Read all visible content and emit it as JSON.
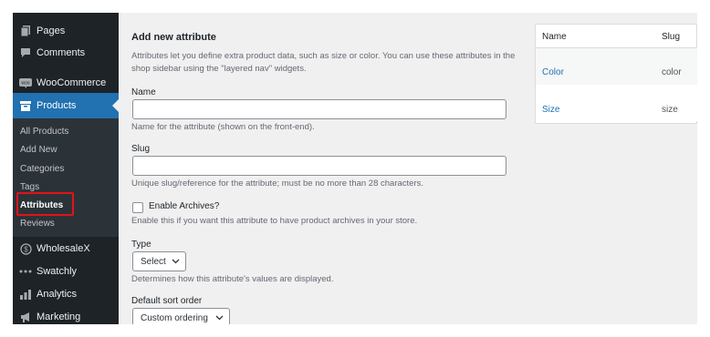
{
  "sidebar": {
    "items": [
      {
        "label": "Pages",
        "icon": "pages-icon"
      },
      {
        "label": "Comments",
        "icon": "comments-icon"
      },
      {
        "label": "WooCommerce",
        "icon": "woocommerce-icon"
      },
      {
        "label": "Products",
        "icon": "products-icon",
        "active": true
      },
      {
        "label": "WholesaleX",
        "icon": "wholesalex-icon"
      },
      {
        "label": "Swatchly",
        "icon": "swatchly-icon"
      },
      {
        "label": "Analytics",
        "icon": "analytics-icon"
      },
      {
        "label": "Marketing",
        "icon": "marketing-icon"
      }
    ],
    "submenu": [
      "All Products",
      "Add New",
      "Categories",
      "Tags",
      "Attributes",
      "Reviews"
    ],
    "current_submenu": "Attributes"
  },
  "form": {
    "title": "Add new attribute",
    "intro": "Attributes let you define extra product data, such as size or color. You can use these attributes in the shop sidebar using the \"layered nav\" widgets.",
    "name_label": "Name",
    "name_value": "",
    "name_desc": "Name for the attribute (shown on the front-end).",
    "slug_label": "Slug",
    "slug_value": "",
    "slug_desc": "Unique slug/reference for the attribute; must be no more than 28 characters.",
    "archives_label": "Enable Archives?",
    "archives_checked": false,
    "archives_desc": "Enable this if you want this attribute to have product archives in your store.",
    "type_label": "Type",
    "type_value": "Select",
    "type_desc": "Determines how this attribute's values are displayed.",
    "sort_label": "Default sort order",
    "sort_value": "Custom ordering"
  },
  "table": {
    "headers": [
      "Name",
      "Slug"
    ],
    "rows": [
      {
        "name": "Color",
        "slug": "color"
      },
      {
        "name": "Size",
        "slug": "size"
      }
    ]
  },
  "colors": {
    "sidebar_bg": "#1d2327",
    "active_bg": "#2271b1",
    "highlight": "#e0131c",
    "link": "#2271b1"
  }
}
